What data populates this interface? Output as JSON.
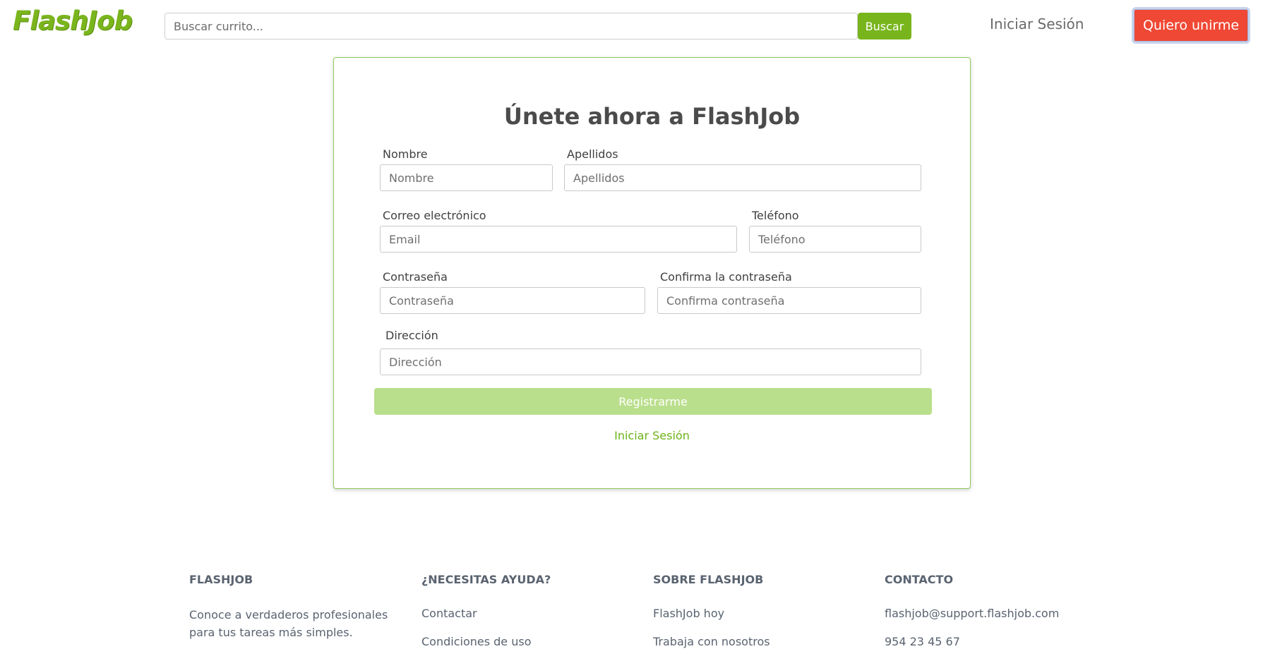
{
  "header": {
    "logo": "FlashJob",
    "search_placeholder": "Buscar currito...",
    "search_button": "Buscar",
    "login_link": "Iniciar Sesión",
    "join_button": "Quiero unirme"
  },
  "form": {
    "title": "Únete ahora a FlashJob",
    "first_name": {
      "label": "Nombre",
      "placeholder": "Nombre"
    },
    "last_name": {
      "label": "Apellidos",
      "placeholder": "Apellidos"
    },
    "email": {
      "label": "Correo electrónico",
      "placeholder": "Email"
    },
    "phone": {
      "label": "Teléfono",
      "placeholder": "Teléfono"
    },
    "password": {
      "label": "Contraseña",
      "placeholder": "Contraseña"
    },
    "confirm_password": {
      "label": "Confirma la contraseña",
      "placeholder": "Confirma contraseña"
    },
    "address": {
      "label": "Dirección",
      "placeholder": "Dirección"
    },
    "submit_button": "Registrarme",
    "login_link": "Iniciar Sesión"
  },
  "footer": {
    "flashjob": {
      "heading": "FLASHJOB",
      "text": "Conoce a verdaderos profesionales para tus tareas más simples."
    },
    "help": {
      "heading": "¿NECESITAS AYUDA?",
      "links": [
        "Contactar",
        "Condiciones de uso"
      ]
    },
    "about": {
      "heading": "SOBRE FLASHJOB",
      "links": [
        "FlashJob hoy",
        "Trabaja con nosotros"
      ]
    },
    "contact": {
      "heading": "CONTACTO",
      "email": "flashjob@support.flashjob.com",
      "phone": "954 23 45 67"
    }
  },
  "colors": {
    "brand_green": "#78b51c",
    "join_red": "#ef4834",
    "submit_disabled_green": "#badf8c",
    "card_border": "#8ccc5a"
  }
}
